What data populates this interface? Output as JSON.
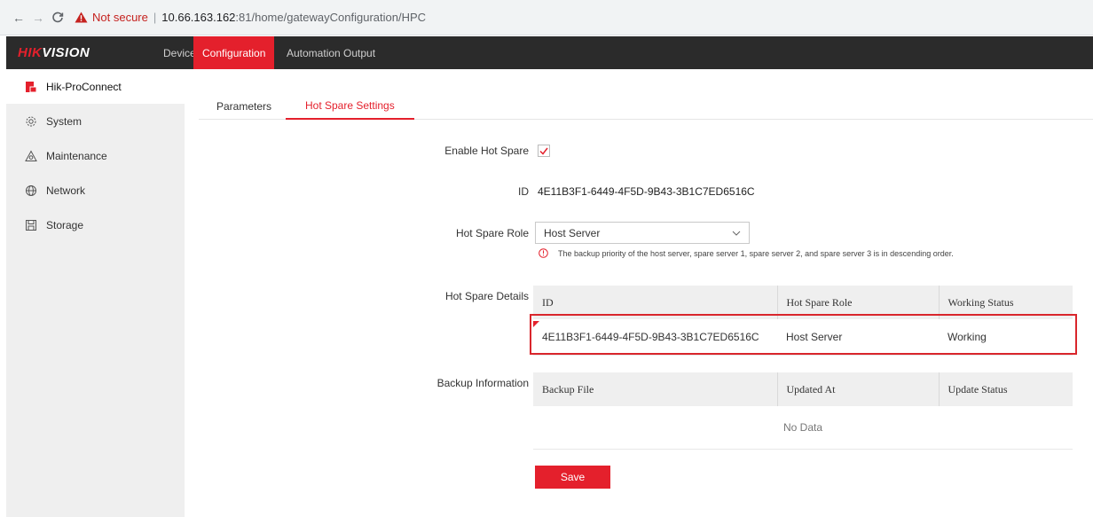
{
  "browser": {
    "security_label": "Not secure",
    "separator": "|",
    "host": "10.66.163.162",
    "path": ":81/home/gatewayConfiguration/HPC"
  },
  "header": {
    "logo_red": "HIK",
    "logo_white": "VISION",
    "nav": {
      "device": "Device",
      "configuration": "Configuration",
      "automation": "Automation Output"
    }
  },
  "sidebar": {
    "items": [
      {
        "label": "Hik-ProConnect",
        "icon": "hpc-icon",
        "active": true
      },
      {
        "label": "System",
        "icon": "gear-icon",
        "active": false
      },
      {
        "label": "Maintenance",
        "icon": "maintenance-icon",
        "active": false
      },
      {
        "label": "Network",
        "icon": "globe-icon",
        "active": false
      },
      {
        "label": "Storage",
        "icon": "storage-icon",
        "active": false
      }
    ]
  },
  "tabs": {
    "parameters": "Parameters",
    "hot_spare": "Hot Spare Settings"
  },
  "form": {
    "enable_label": "Enable Hot Spare",
    "enable_checked": true,
    "id_label": "ID",
    "id_value": "4E11B3F1-6449-4F5D-9B43-3B1C7ED6516C",
    "role_label": "Hot Spare Role",
    "role_value": "Host Server",
    "hint": "The backup priority of the host server, spare server 1, spare server 2, and spare server 3 is in descending order.",
    "details_label": "Hot Spare Details",
    "backup_label": "Backup Information",
    "save_label": "Save"
  },
  "details_table": {
    "headers": [
      "ID",
      "Hot Spare Role",
      "Working Status"
    ],
    "rows": [
      [
        "4E11B3F1-6449-4F5D-9B43-3B1C7ED6516C",
        "Host Server",
        "Working"
      ]
    ]
  },
  "backup_table": {
    "headers": [
      "Backup File",
      "Updated At",
      "Update Status"
    ],
    "empty_text": "No Data"
  },
  "colors": {
    "accent": "#e4202c",
    "header_bg": "#2b2b2b",
    "sidebar_bg": "#efefef"
  }
}
